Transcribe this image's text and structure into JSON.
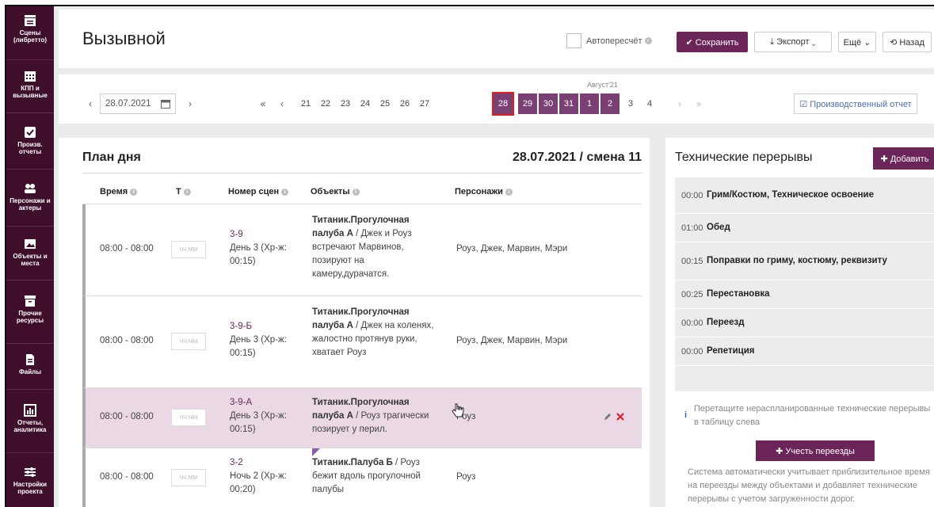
{
  "sidebar": {
    "items": [
      {
        "label": "Сцены (либретто)",
        "icon": "clapperboard-icon"
      },
      {
        "label": "КПП и вызывные",
        "icon": "calendar-grid-icon"
      },
      {
        "label": "Произв. отчеты",
        "icon": "checkbox-icon"
      },
      {
        "label": "Персонажи и актеры",
        "icon": "people-icon"
      },
      {
        "label": "Объекты и места",
        "icon": "image-icon"
      },
      {
        "label": "Прочие ресурсы",
        "icon": "archive-icon"
      },
      {
        "label": "Файлы",
        "icon": "file-icon"
      },
      {
        "label": "Отчеты, аналитика",
        "icon": "bar-chart-icon"
      },
      {
        "label": "Настройки проекта",
        "icon": "sliders-icon"
      }
    ]
  },
  "header": {
    "title": "Вызывной",
    "autocalc_label": "Автопересчёт",
    "save_label": "✔ Сохранить",
    "export_label": "⤓ Экспорт ⌄",
    "more_label": "Ещё ⌄",
    "back_label": "⟲ Назад"
  },
  "datebar": {
    "date_value": "28.07.2021",
    "month_label": "Август'21",
    "days": [
      "21",
      "22",
      "23",
      "24",
      "25",
      "26",
      "27",
      "28",
      "29",
      "30",
      "31",
      "1",
      "2",
      "3",
      "4"
    ],
    "report_label": "☑ Производственный отчет"
  },
  "plan": {
    "title": "План дня",
    "date_shift": "28.07.2021 / смена 11",
    "columns": [
      "Время",
      "Т",
      "Номер сцен",
      "Объекты",
      "Персонажи"
    ],
    "t_placeholder": "ЧЧ:ММ",
    "rows": [
      {
        "time": "08:00 - 08:00",
        "scene_no": "3-9",
        "scene_desc": "День 3 (Хр-ж: 00:15)",
        "object_name": "Титаник.Прогулочная палуба А",
        "object_desc": " / Джек и Роуз встречают Марвинов, позируют на камеру,дурачатся.",
        "characters": "Роуз, Джек, Марвин, Мэри"
      },
      {
        "time": "08:00 - 08:00",
        "scene_no": "3-9-Б",
        "scene_desc": "День 3 (Хр-ж: 00:15)",
        "object_name": "Титаник.Прогулочная палуба А",
        "object_desc": " / Джек на коленях, жалостно протянув руки, хватает Роуз",
        "characters": "Роуз, Джек, Марвин, Мэри"
      },
      {
        "time": "08:00 - 08:00",
        "scene_no": "3-9-А",
        "scene_desc": "День 3 (Хр-ж: 00:15)",
        "object_name": "Титаник.Прогулочная палуба А",
        "object_desc": " / Роуз трагически позирует у перил.",
        "characters": "Роуз"
      },
      {
        "time": "08:00 - 08:00",
        "scene_no": "3-2",
        "scene_desc": "Ночь 2 (Хр-ж: 00:20)",
        "object_name": "Титаник.Палуба Б",
        "object_desc": " / Роуз бежит вдоль прогулочной палубы",
        "characters": "Роуз"
      }
    ]
  },
  "tech": {
    "title": "Технические перерывы",
    "add_label": "✚ Добавить",
    "items": [
      {
        "time": "00:00",
        "name": "Грим/Костюм, Техническое освоение"
      },
      {
        "time": "01:00",
        "name": "Обед"
      },
      {
        "time": "00:15",
        "name": "Поправки по гриму, костюму, реквизиту"
      },
      {
        "time": "00:25",
        "name": "Перестановка"
      },
      {
        "time": "00:00",
        "name": "Переезд"
      },
      {
        "time": "00:00",
        "name": "Репетиция"
      }
    ],
    "hint1": "Перетащите нераспланированные технические перерывы в таблицу слева",
    "route_label": "✚ Учесть переезды",
    "hint2": "Система автоматически учитывает приблизительное время на переезды между объектами и добавляет технические перерывы с учетом загруженности дорог."
  },
  "colors": {
    "brand": "#6b2558",
    "sidebar": "#3e0e2a",
    "selected_border": "#e01e1e"
  }
}
